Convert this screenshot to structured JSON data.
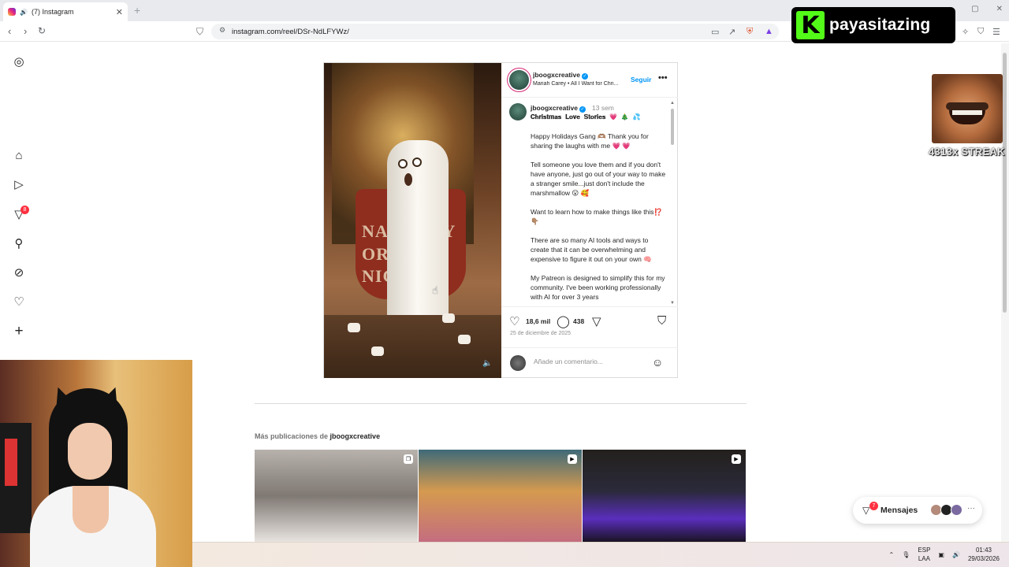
{
  "browser": {
    "tab_title": "(7) Instagram",
    "tab_close": "✕",
    "new_tab": "+",
    "url": "instagram.com/reel/DSr-NdLFYWz/"
  },
  "overlay": {
    "brand_letter": "K",
    "brand_name": "payasitazing",
    "streak_text": "4313x STREAK"
  },
  "nav": {
    "notifications_badge": "8"
  },
  "post": {
    "header_username": "jboogxcreative",
    "song": "Mariah Carey • All I Want for Chri...",
    "follow_label": "Seguir",
    "more_label": "•••",
    "caption_username": "jboogxcreative",
    "caption_time": "13 sem",
    "caption_title": "𝐂𝐡𝐫𝐢𝐬𝐭𝐦𝐚𝐬 𝐋𝐨𝐯𝐞 𝐒𝐭𝐨𝐫𝐢𝐞𝐬 💗 🎄 💦",
    "caption_paragraphs": [
      "Happy Holidays Gang 🫶🏽 Thank you for sharing the laughs with me 💗 💗",
      "Tell someone you love them and if you don't have anyone, just go out of your way to make a stranger smile...just don't include the marshmallow 😮 🥰",
      "Want to learn how to make things like this⁉️ 👇🏽",
      "There are so many AI tools and ways to create that it can be overwhelming and expensive to figure it out on your own 🧠",
      "My Patreon is designed to simplify this for my community. I've been working professionally with AI for over 3 years"
    ],
    "likes": "18,6 mil",
    "comments": "438",
    "date": "25 de diciembre de 2025",
    "comment_placeholder": "Añade un comentario...",
    "reel_text": "NAUGHTY OR NICE"
  },
  "more_posts": {
    "prefix": "Más publicaciones de",
    "username": "jboogxcreative"
  },
  "messages": {
    "label": "Mensajes",
    "badge": "7",
    "more": "···"
  },
  "taskbar": {
    "lang_top": "ESP",
    "lang_bottom": "LAA",
    "time": "01:43",
    "date": "29/03/2026"
  },
  "colors": {
    "accent": "#0095f6",
    "badge": "#ff3040",
    "kick_green": "#53fc18"
  }
}
